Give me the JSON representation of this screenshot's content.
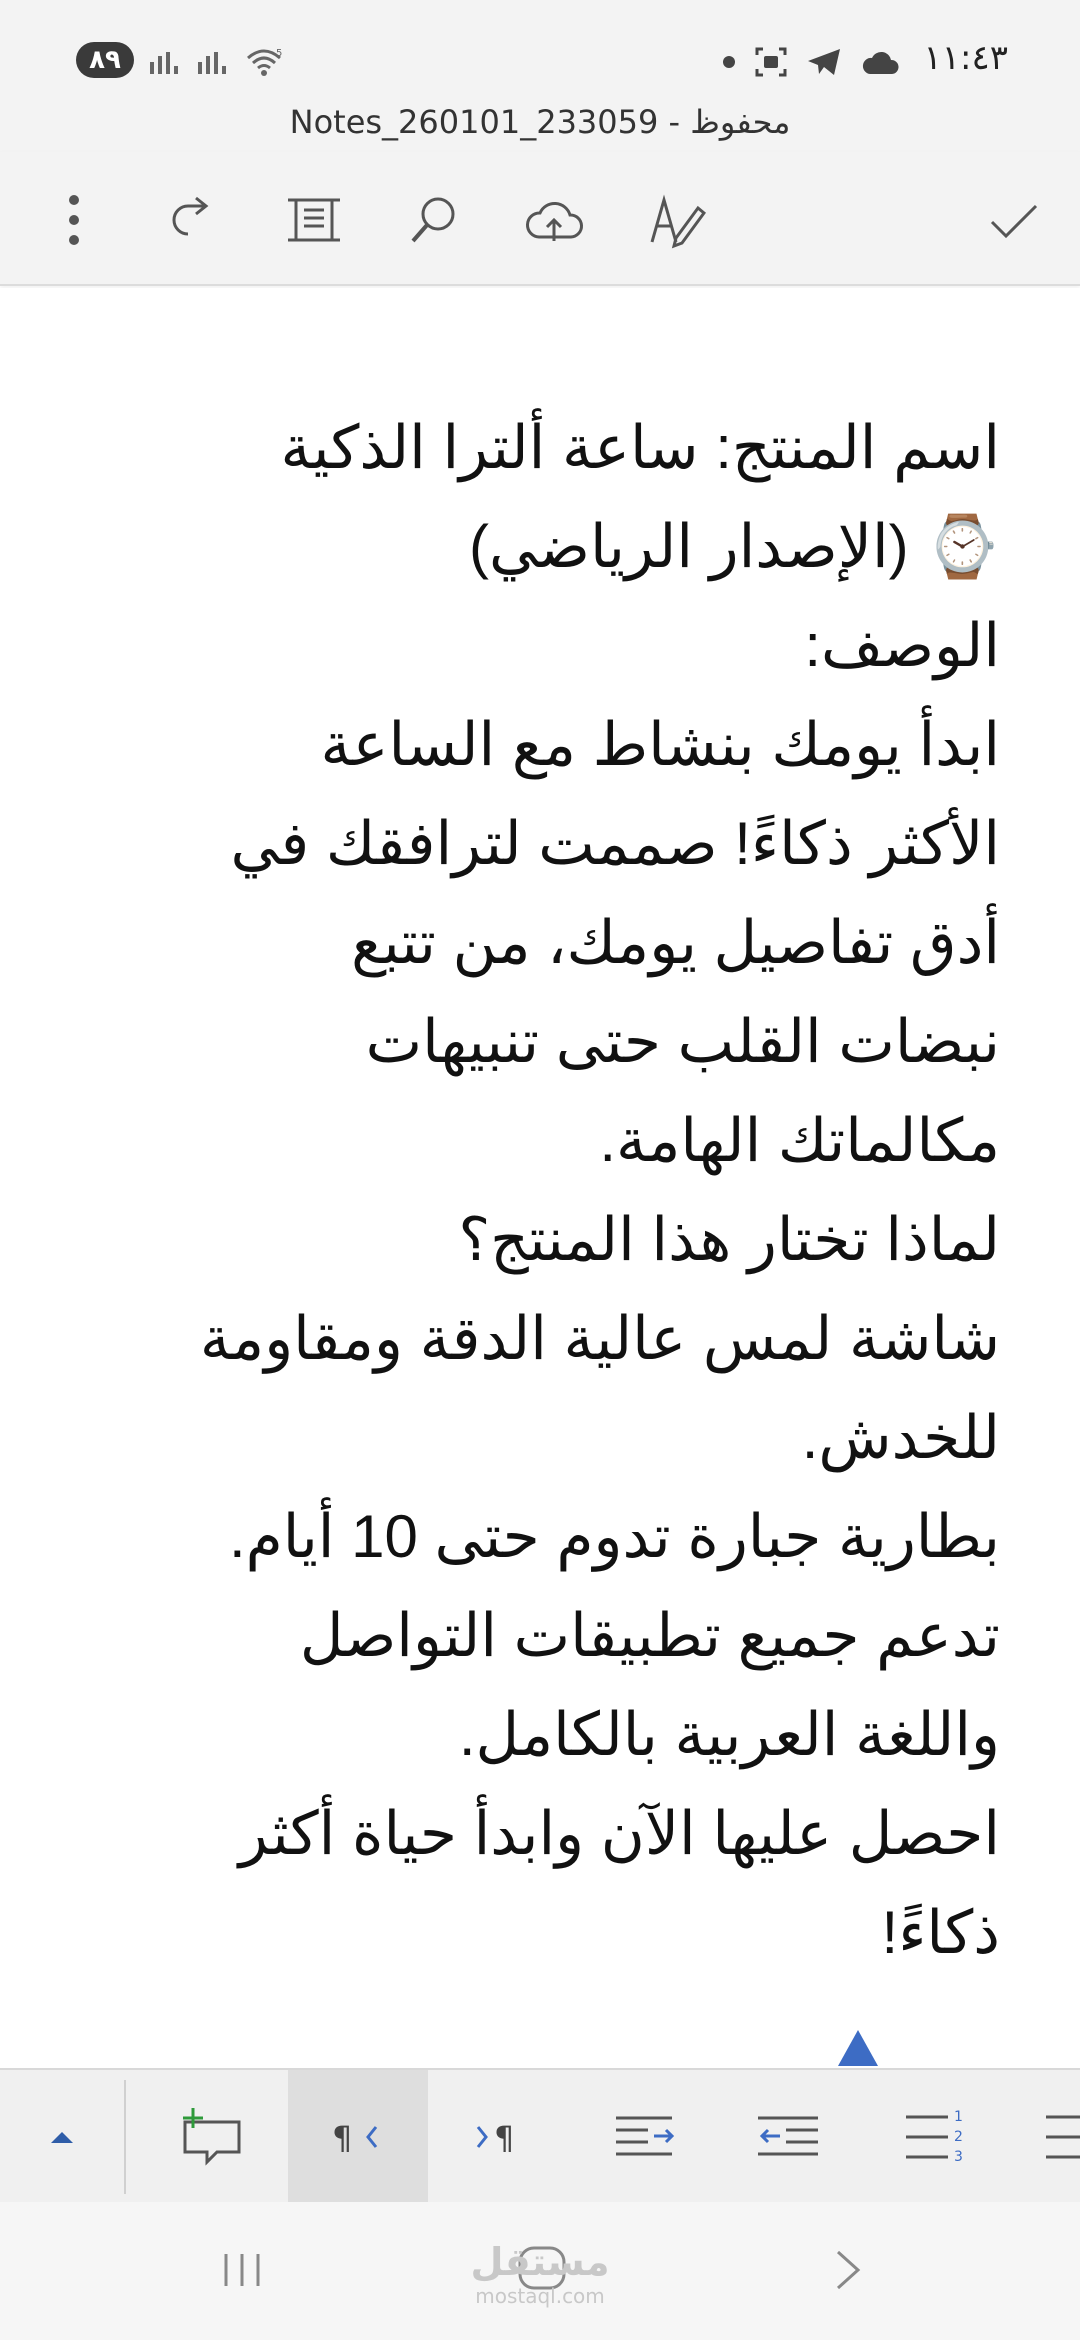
{
  "status_bar": {
    "battery": "٨٩",
    "time": "١١:٤٣",
    "wifi_badge": "5",
    "icons": [
      "battery-icon",
      "signal-icon",
      "signal-icon",
      "wifi-icon",
      "dot-icon",
      "screenshot-icon",
      "telegram-icon",
      "cloud-icon"
    ]
  },
  "title_bar": {
    "title": "Notes_260101_233059 - محفوظ"
  },
  "toolbar": {
    "icons": [
      "more-vertical-icon",
      "redo-icon",
      "reading-view-icon",
      "search-icon",
      "cloud-upload-icon",
      "edit-pen-icon",
      "checkmark-icon"
    ]
  },
  "document": {
    "lines": [
      "اسم المنتج: ساعة ألترا الذكية",
      "⌚ (الإصدار الرياضي)",
      "الوصف:",
      "ابدأ يومك بنشاط مع الساعة",
      "الأكثر ذكاءً! صممت لترافقك في",
      "أدق تفاصيل يومك، من تتبع",
      "نبضات القلب حتى تنبيهات",
      "مكالماتك الهامة.",
      "لماذا تختار هذا المنتج؟",
      "شاشة لمس عالية الدقة ومقاومة",
      "للخدش.",
      "بطارية جبارة تدوم حتى 10 أيام.",
      "تدعم جميع تطبيقات التواصل",
      "واللغة العربية بالكامل.",
      "احصل عليها الآن وابدأ حياة أكثر",
      "ذكاءً!"
    ]
  },
  "ribbon": {
    "buttons": [
      "collapse-up-icon",
      "new-comment-icon",
      "rtl-paragraph-icon",
      "ltr-paragraph-icon",
      "increase-indent-icon",
      "decrease-indent-icon",
      "numbered-list-icon",
      "bulleted-list-icon"
    ],
    "active": "rtl-paragraph-icon"
  },
  "nav_bar": {
    "watermark": "مستقل",
    "watermark_sub": "mostaql.com"
  },
  "colors": {
    "chrome_bg": "#f3f3f3",
    "accent_blue": "#3d6cc4",
    "icon_gray": "#555555"
  }
}
